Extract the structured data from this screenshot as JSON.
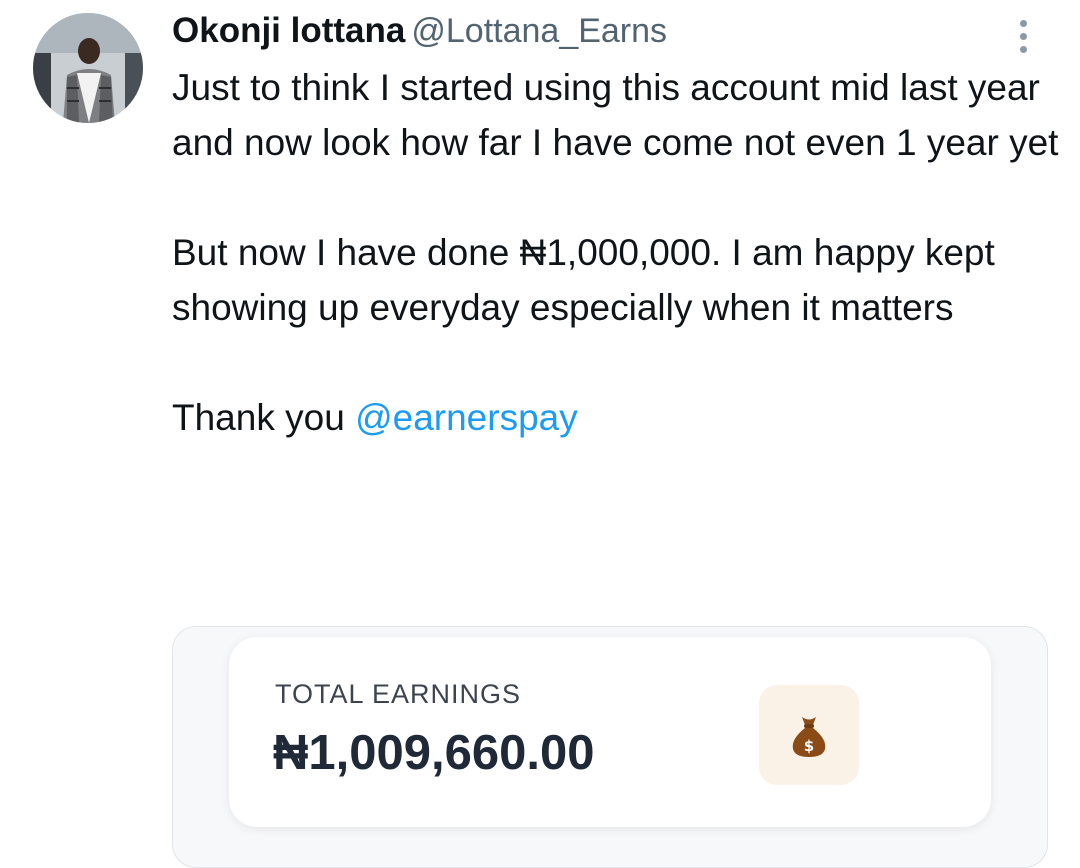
{
  "tweet": {
    "author_name": "Okonji lottana",
    "author_handle": "@Lottana_Earns",
    "paragraph1": "Just to think I started using this account mid last year and now look how far I have come not even 1 year yet",
    "paragraph2": "But now I have done ₦1,000,000. I am happy kept showing up everyday especially when it matters",
    "paragraph3_prefix": "Thank you ",
    "mention": "@earnerspay"
  },
  "earnings_card": {
    "label": "TOTAL EARNINGS",
    "amount": "₦1,009,660.00",
    "icon": "money-bag-icon"
  },
  "colors": {
    "mention": "#1d9bf0",
    "handle": "#536471",
    "bag_tile": "#fbf2e7",
    "bag": "#8a4b16"
  }
}
